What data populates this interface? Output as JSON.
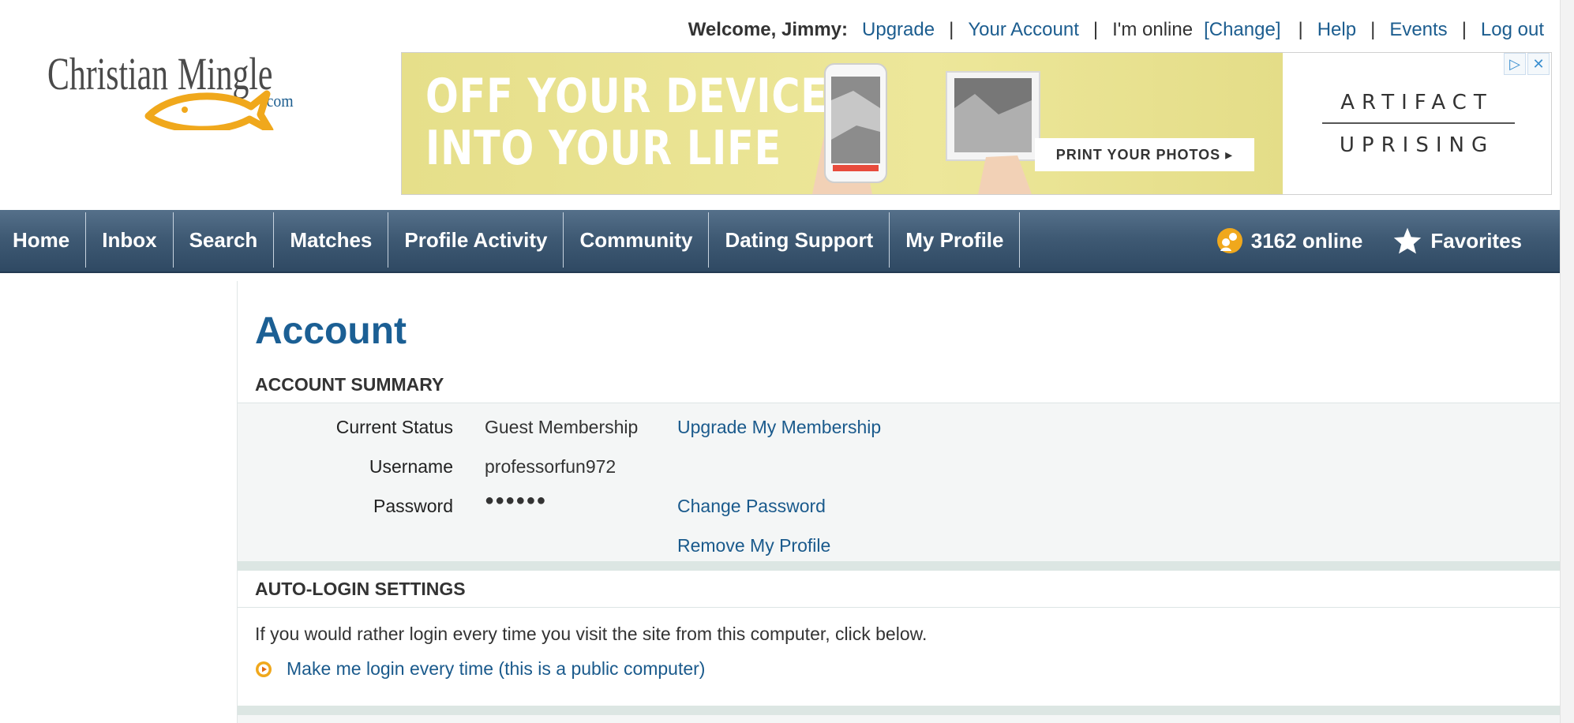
{
  "topbar": {
    "welcome": "Welcome, Jimmy:",
    "upgrade": "Upgrade",
    "your_account": "Your Account",
    "online_status": "I'm online",
    "change": "[Change]",
    "help": "Help",
    "events": "Events",
    "logout": "Log out",
    "separator": "|"
  },
  "logo": {
    "text_main": "Christian",
    "text_accent": "Mingle",
    "text_domain": ".com"
  },
  "ad": {
    "headline_line1": "OFF YOUR DEVICE",
    "headline_line2": "INTO YOUR LIFE",
    "cta": "PRINT YOUR PHOTOS ▸",
    "brand_line1": "ARTIFACT",
    "brand_line2": "UPRISING",
    "adchoices_icon": "▷",
    "close_icon": "✕"
  },
  "nav": {
    "items": [
      "Home",
      "Inbox",
      "Search",
      "Matches",
      "Profile Activity",
      "Community",
      "Dating Support",
      "My Profile"
    ],
    "online_count": "3162 online",
    "favorites": "Favorites"
  },
  "page": {
    "title": "Account"
  },
  "account_summary": {
    "heading": "ACCOUNT SUMMARY",
    "rows": [
      {
        "label": "Current Status",
        "value": "Guest Membership",
        "link": "Upgrade My Membership"
      },
      {
        "label": "Username",
        "value": "professorfun972",
        "link": ""
      },
      {
        "label": "Password",
        "value": "●●●●●●",
        "link": "Change Password"
      }
    ],
    "remove_link": "Remove My Profile"
  },
  "auto_login": {
    "heading": "AUTO-LOGIN SETTINGS",
    "description": "If you would rather login every time you visit the site from this computer, click below.",
    "link": "Make me login every time (this is a public computer)"
  },
  "colors": {
    "link": "#1a5a8c",
    "title": "#1b5f94",
    "nav_bg": "#3f5a74",
    "panel_bg": "#f4f6f6",
    "logo_gold": "#f0a81c"
  }
}
